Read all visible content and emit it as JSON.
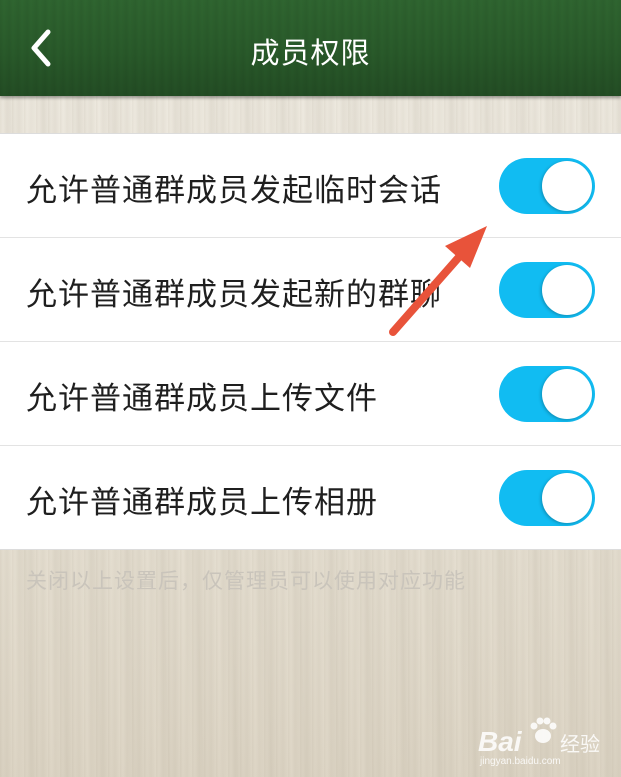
{
  "header": {
    "title": "成员权限",
    "back_icon": "chevron-left-icon"
  },
  "settings": {
    "items": [
      {
        "label": "允许普通群成员发起临时会话",
        "enabled": true
      },
      {
        "label": "允许普通群成员发起新的群聊",
        "enabled": true
      },
      {
        "label": "允许普通群成员上传文件",
        "enabled": true
      },
      {
        "label": "允许普通群成员上传相册",
        "enabled": true
      }
    ],
    "note": "关闭以上设置后，仅管理员可以使用对应功能"
  },
  "colors": {
    "nav_green": "#2a5c2b",
    "toggle_on": "#11bcf2",
    "annotation_arrow": "#e8533a"
  },
  "watermark": {
    "brand": "Bai",
    "brand_cn": "经验",
    "url": "jingyan.baidu.com"
  }
}
